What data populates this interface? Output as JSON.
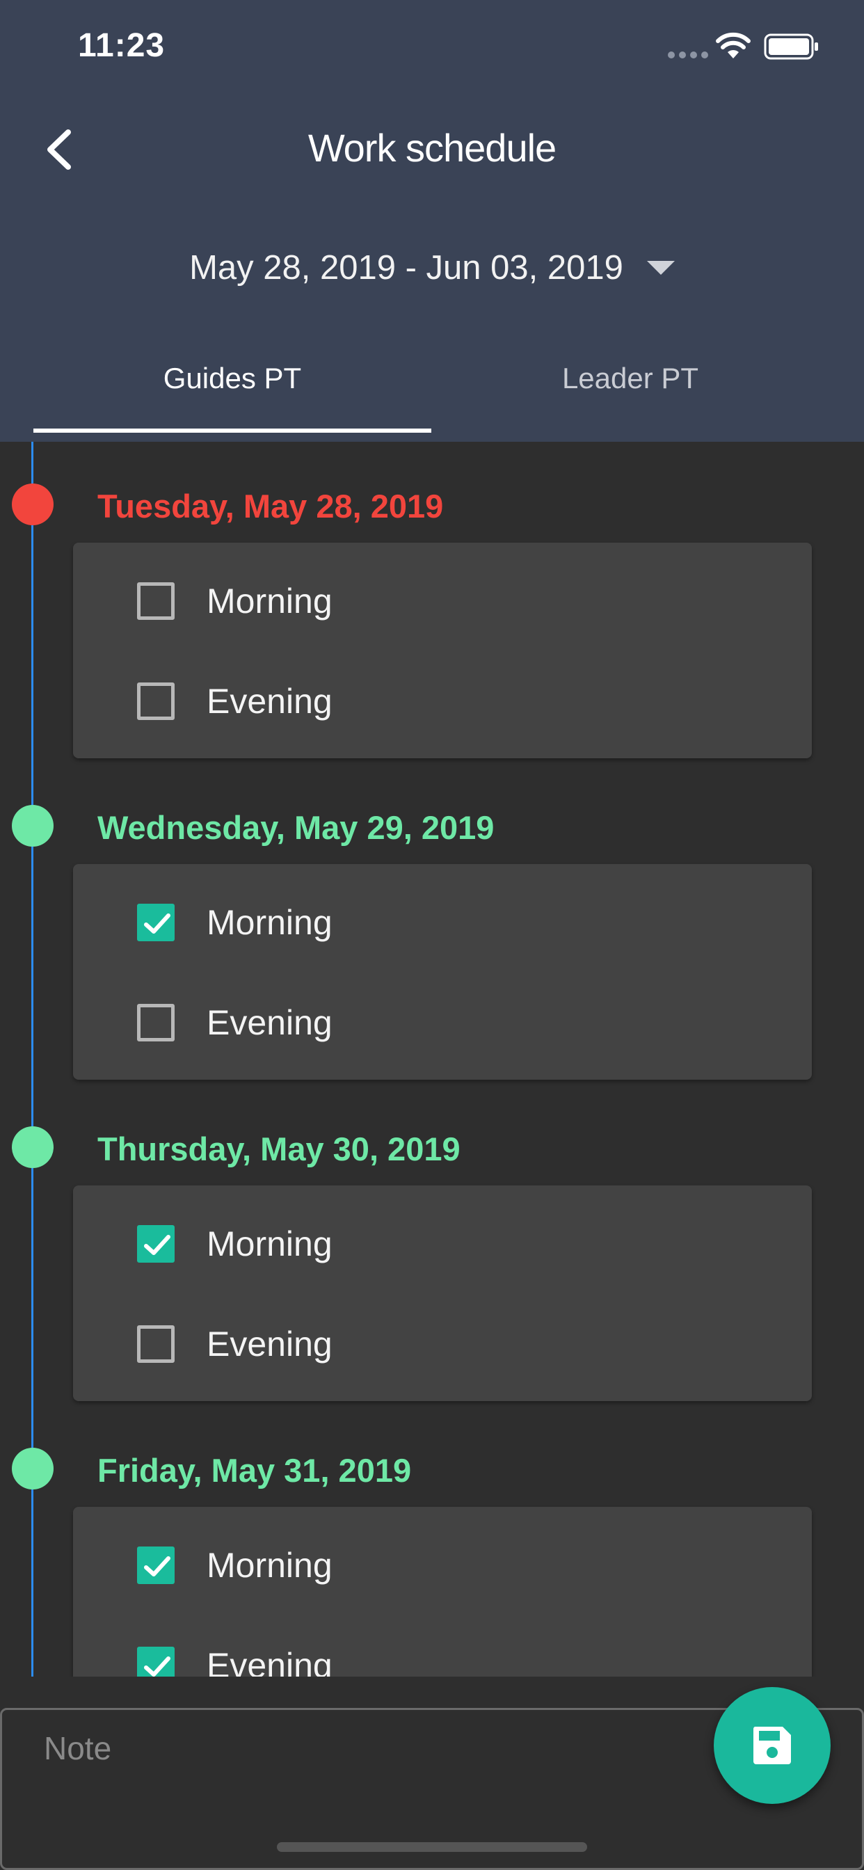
{
  "status_bar": {
    "time": "11:23"
  },
  "header": {
    "title": "Work schedule",
    "date_range": "May 28, 2019 - Jun 03, 2019"
  },
  "tabs": [
    {
      "label": "Guides PT",
      "selected": true
    },
    {
      "label": "Leader PT",
      "selected": false
    }
  ],
  "colors": {
    "header_bg": "#3a4356",
    "today_red": "#f2453d",
    "day_green": "#6ee8a6",
    "accent_teal": "#1abc9c",
    "timeline_blue": "#2c8cf0"
  },
  "days": [
    {
      "date": "Tuesday, May 28, 2019",
      "highlight": "red",
      "shifts": [
        {
          "label": "Morning",
          "checked": false
        },
        {
          "label": "Evening",
          "checked": false
        }
      ]
    },
    {
      "date": "Wednesday, May 29, 2019",
      "highlight": "green",
      "shifts": [
        {
          "label": "Morning",
          "checked": true
        },
        {
          "label": "Evening",
          "checked": false
        }
      ]
    },
    {
      "date": "Thursday, May 30, 2019",
      "highlight": "green",
      "shifts": [
        {
          "label": "Morning",
          "checked": true
        },
        {
          "label": "Evening",
          "checked": false
        }
      ]
    },
    {
      "date": "Friday, May 31, 2019",
      "highlight": "green",
      "shifts": [
        {
          "label": "Morning",
          "checked": true
        },
        {
          "label": "Evening",
          "checked": true
        }
      ]
    }
  ],
  "note": {
    "placeholder": "Note"
  },
  "icons": {
    "back": "chevron-left-icon",
    "dropdown": "caret-down-icon",
    "save": "floppy-disk-icon"
  }
}
